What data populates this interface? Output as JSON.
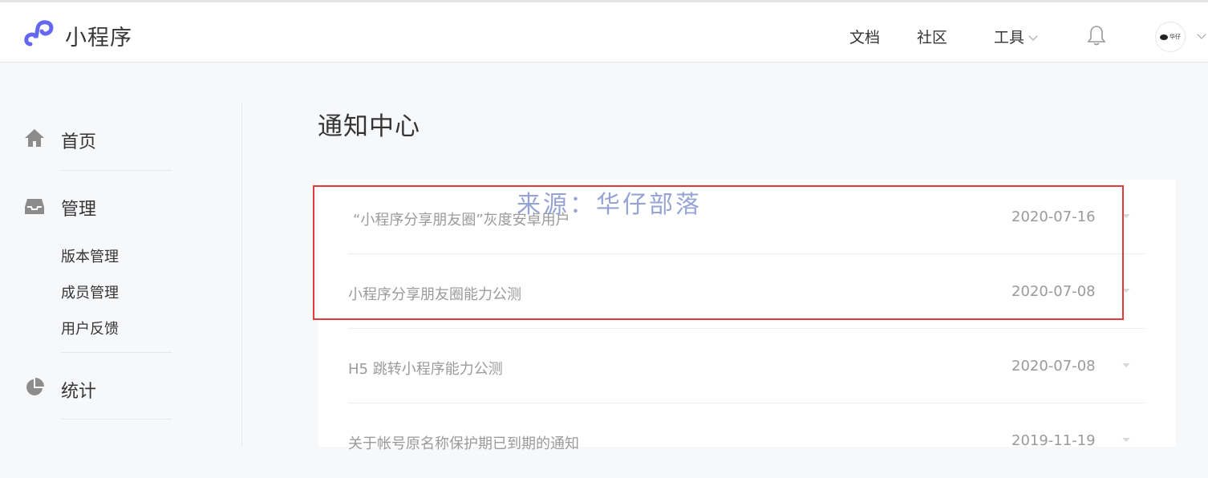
{
  "header": {
    "logo_text": "小程序",
    "nav": {
      "docs": "文档",
      "community": "社区",
      "tools": "工具"
    },
    "avatar_text": "华仔"
  },
  "sidebar": {
    "home": "首页",
    "manage": "管理",
    "manage_items": [
      "版本管理",
      "成员管理",
      "用户反馈"
    ],
    "stats": "统计"
  },
  "main": {
    "title": "通知中心",
    "notices": [
      {
        "title": "“小程序分享朋友圈”灰度安卓用户",
        "date": "2020-07-16"
      },
      {
        "title": "小程序分享朋友圈能力公测",
        "date": "2020-07-08"
      },
      {
        "title": "H5 跳转小程序能力公测",
        "date": "2020-07-08"
      },
      {
        "title": "关于帐号原名称保护期已到期的通知",
        "date": "2019-11-19"
      }
    ]
  },
  "watermark": "来源：华仔部落",
  "colors": {
    "brand": "#6467f0",
    "highlight": "#e03c3c",
    "muted_text": "#9a9a9a"
  }
}
